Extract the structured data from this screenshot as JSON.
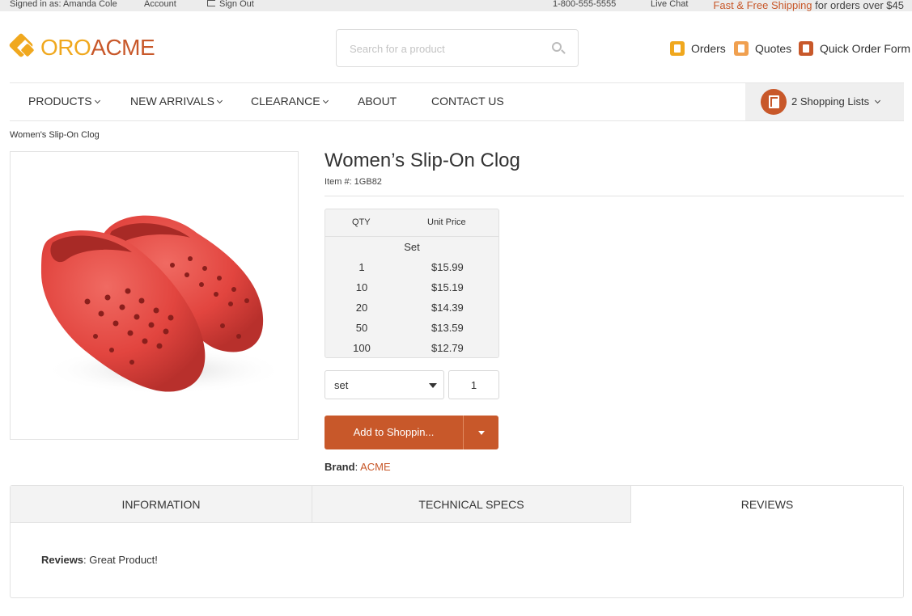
{
  "topbar": {
    "signed_in": "Signed in as: Amanda Cole",
    "account": "Account",
    "sign_out": "Sign Out",
    "phone": "1-800-555-5555",
    "live_chat": "Live Chat",
    "shipping_highlight": "Fast & Free Shipping",
    "shipping_rest": " for orders over $45"
  },
  "header": {
    "logo_part1": "ORO",
    "logo_part2": "ACME",
    "search_placeholder": "Search for a product",
    "orders": "Orders",
    "quotes": "Quotes",
    "quick_order": "Quick Order Form"
  },
  "nav": {
    "items": [
      "PRODUCTS",
      "NEW ARRIVALS",
      "CLEARANCE",
      "ABOUT",
      "CONTACT US"
    ],
    "shopping_lists": "2 Shopping Lists"
  },
  "breadcrumb": "Women's Slip-On Clog",
  "product": {
    "title": "Women’s Slip-On Clog",
    "item_no": "Item #: 1GB82",
    "price_table": {
      "qty_header": "QTY",
      "price_header": "Unit Price",
      "unit": "Set",
      "rows": [
        {
          "qty": "1",
          "price": "$15.99"
        },
        {
          "qty": "10",
          "price": "$15.19"
        },
        {
          "qty": "20",
          "price": "$14.39"
        },
        {
          "qty": "50",
          "price": "$13.59"
        },
        {
          "qty": "100",
          "price": "$12.79"
        }
      ]
    },
    "unit_select": "set",
    "quantity": "1",
    "add_button": "Add to Shoppin...",
    "brand_label": "Brand",
    "brand_value": "ACME"
  },
  "tabs": {
    "information": "INFORMATION",
    "technical_specs": "TECHNICAL SPECS",
    "reviews": "REVIEWS",
    "reviews_label": "Reviews",
    "reviews_text": "Great Product!"
  },
  "colors": {
    "accent": "#c8582a",
    "logo_yellow": "#f0a81e",
    "clog": "#e84a45"
  }
}
